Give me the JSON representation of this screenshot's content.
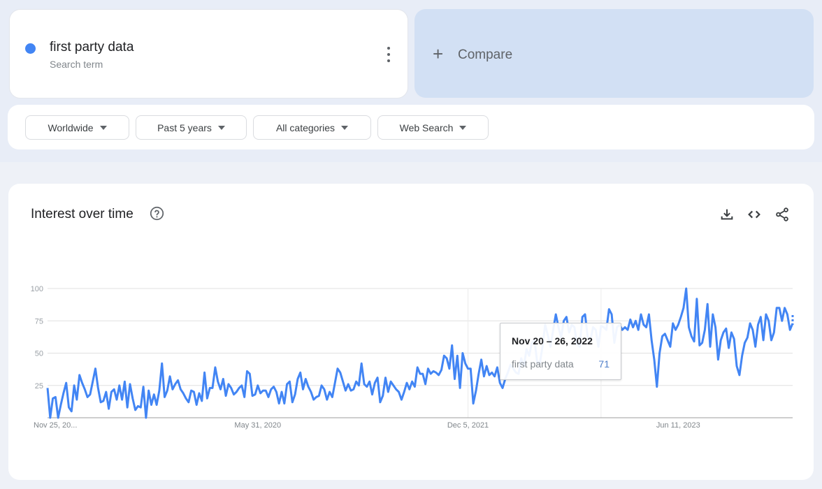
{
  "search_term": {
    "name": "first party data",
    "subtitle": "Search term",
    "color": "#4285f4"
  },
  "compare": {
    "label": "Compare",
    "icon": "plus-icon"
  },
  "filters": [
    {
      "label": "Worldwide"
    },
    {
      "label": "Past 5 years"
    },
    {
      "label": "All categories"
    },
    {
      "label": "Web Search"
    }
  ],
  "panel": {
    "title": "Interest over time",
    "help_icon": "help-circle-icon",
    "actions": [
      {
        "name": "download",
        "icon": "download-icon"
      },
      {
        "name": "embed",
        "icon": "code-icon"
      },
      {
        "name": "share",
        "icon": "share-icon"
      }
    ]
  },
  "tooltip": {
    "date": "Nov 20 – 26, 2022",
    "term": "first party data",
    "value": "71"
  },
  "chart_data": {
    "type": "line",
    "title": "Interest over time",
    "xlabel": "",
    "ylabel": "",
    "ylim": [
      0,
      100
    ],
    "yticks": [
      25,
      50,
      75,
      100
    ],
    "xtick_labels": [
      "Nov 25, 20...",
      "May 31, 2020",
      "Dec 5, 2021",
      "Jun 11, 2023"
    ],
    "xtick_indices": [
      0,
      79,
      158,
      237
    ],
    "grid": true,
    "legend": "none",
    "line_color": "#4285f4",
    "highlight_index": 208,
    "series": [
      {
        "name": "first party data",
        "values": [
          23,
          0,
          15,
          16,
          0,
          10,
          19,
          27,
          8,
          5,
          25,
          14,
          33,
          27,
          22,
          16,
          18,
          28,
          38,
          23,
          12,
          13,
          20,
          7,
          20,
          22,
          14,
          25,
          14,
          28,
          8,
          26,
          15,
          6,
          9,
          8,
          24,
          0,
          21,
          10,
          18,
          10,
          21,
          42,
          16,
          21,
          32,
          22,
          26,
          29,
          22,
          19,
          15,
          12,
          21,
          20,
          10,
          19,
          13,
          35,
          15,
          23,
          23,
          39,
          28,
          22,
          30,
          17,
          26,
          23,
          18,
          20,
          23,
          25,
          16,
          36,
          34,
          17,
          18,
          25,
          19,
          21,
          21,
          16,
          22,
          24,
          20,
          11,
          20,
          11,
          26,
          28,
          12,
          18,
          30,
          35,
          22,
          30,
          24,
          20,
          14,
          16,
          17,
          25,
          22,
          14,
          20,
          16,
          27,
          38,
          35,
          28,
          21,
          26,
          21,
          22,
          28,
          25,
          42,
          26,
          24,
          28,
          18,
          27,
          31,
          12,
          17,
          31,
          20,
          28,
          25,
          22,
          20,
          14,
          20,
          27,
          22,
          28,
          24,
          39,
          34,
          34,
          26,
          38,
          34,
          36,
          35,
          33,
          37,
          48,
          46,
          38,
          56,
          30,
          48,
          23,
          50,
          42,
          38,
          38,
          11,
          21,
          34,
          45,
          32,
          40,
          33,
          35,
          32,
          39,
          27,
          23,
          30,
          35,
          41,
          38,
          35,
          34,
          46,
          40,
          53,
          48,
          58,
          60,
          43,
          42,
          55,
          72,
          64,
          55,
          68,
          80,
          70,
          62,
          75,
          78,
          66,
          72,
          70,
          57,
          55,
          78,
          80,
          62,
          60,
          70,
          68,
          55,
          71,
          70,
          68,
          84,
          80,
          58,
          70,
          72,
          68,
          70,
          68,
          76,
          70,
          75,
          68,
          80,
          72,
          70,
          80,
          60,
          45,
          24,
          50,
          63,
          65,
          60,
          55,
          73,
          68,
          72,
          78,
          85,
          100,
          70,
          63,
          59,
          92,
          56,
          58,
          68,
          88,
          55,
          80,
          70,
          45,
          60,
          66,
          69,
          54,
          66,
          61,
          40,
          33,
          48,
          58,
          62,
          73,
          68,
          55,
          72,
          78,
          60,
          80,
          75,
          60,
          66,
          85,
          85,
          75,
          85,
          80,
          68,
          73
        ]
      }
    ]
  }
}
